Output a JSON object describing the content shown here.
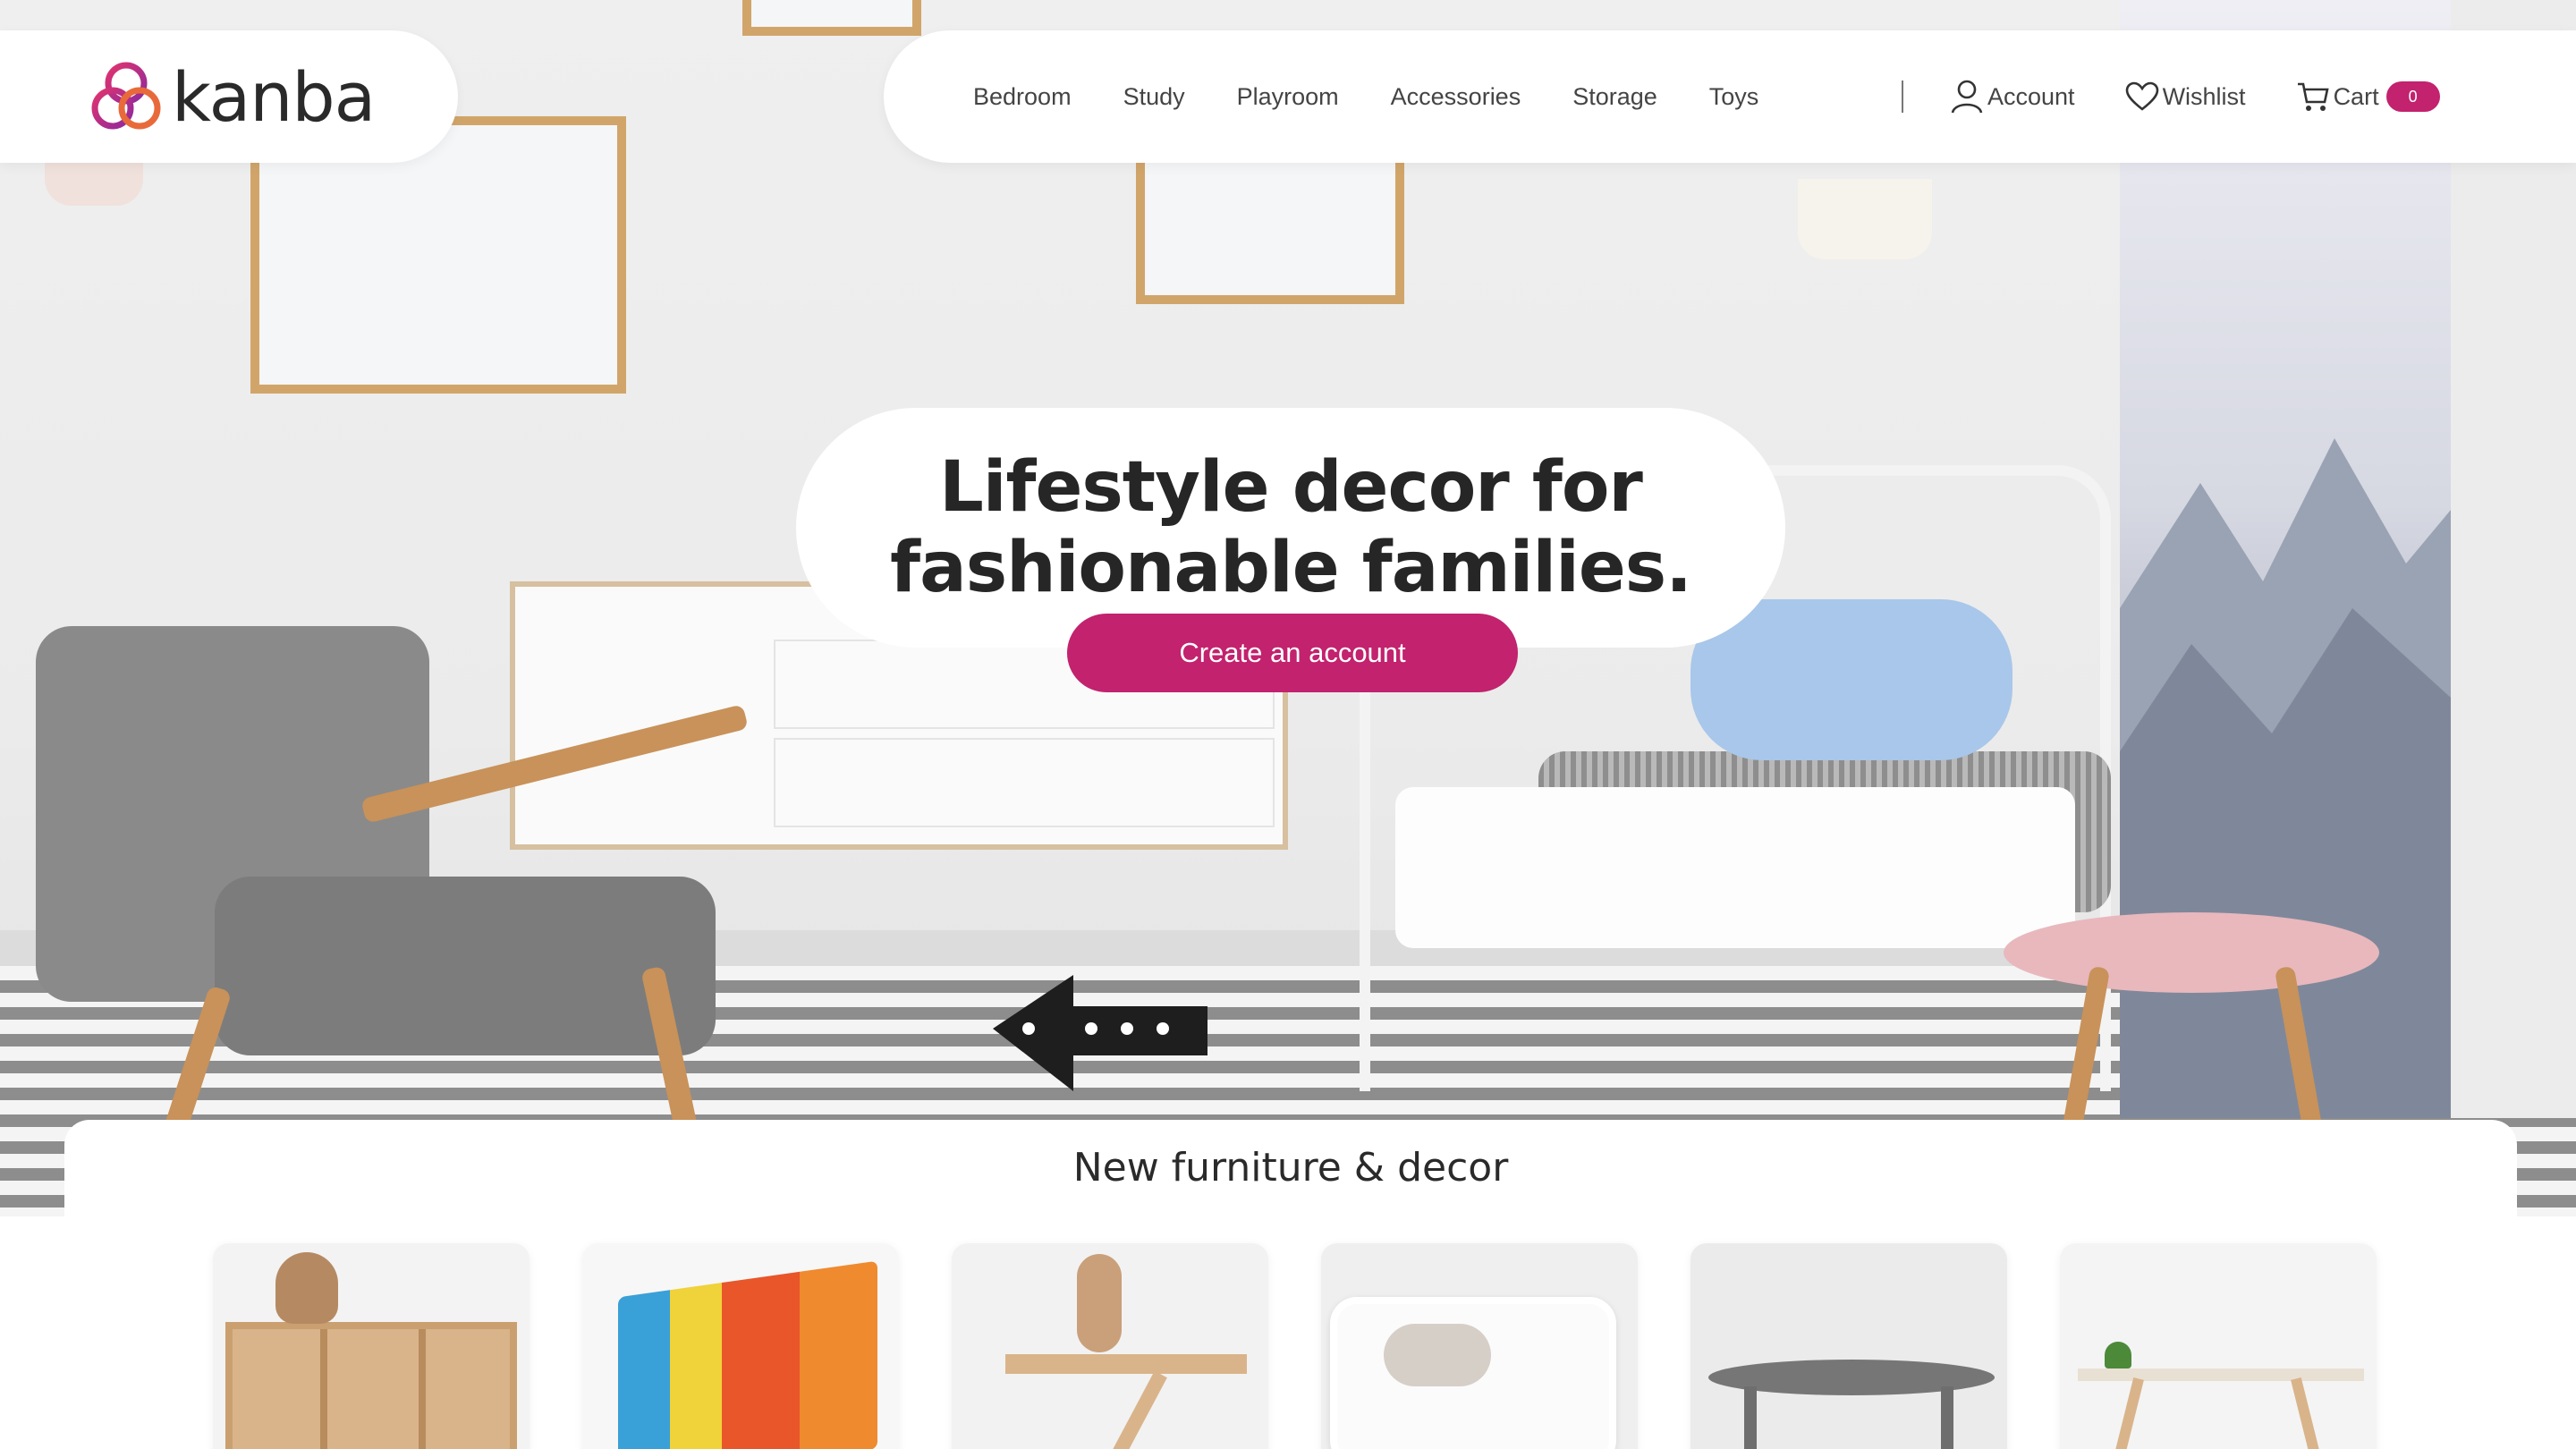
{
  "brand": {
    "name": "kanba",
    "logo_icon": "interlocking-rings-logo",
    "accent_color": "#c2226e"
  },
  "nav": {
    "links": [
      "Bedroom",
      "Study",
      "Playroom",
      "Accessories",
      "Storage",
      "Toys"
    ],
    "account_label": "Account",
    "wishlist_label": "Wishlist",
    "cart_label": "Cart",
    "cart_count": "0"
  },
  "hero": {
    "title_line1": "Lifestyle decor for",
    "title_line2": "fashionable families.",
    "cta_label": "Create an account"
  },
  "products_section": {
    "title": "New furniture & decor",
    "cards": [
      {
        "image": "wooden-shelf-with-toys"
      },
      {
        "image": "book-display-rack"
      },
      {
        "image": "wooden-desk-with-bunny"
      },
      {
        "image": "white-toddler-bed"
      },
      {
        "image": "round-grey-table"
      },
      {
        "image": "trestle-desk-with-plant"
      }
    ]
  },
  "icons": {
    "account": "user-icon",
    "wishlist": "heart-icon",
    "cart": "cart-icon"
  }
}
